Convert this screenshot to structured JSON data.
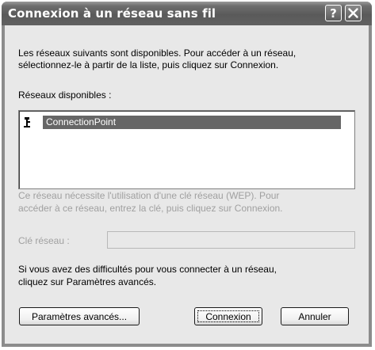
{
  "window": {
    "title": "Connexion à un réseau sans fil",
    "help_icon": "help-question-icon",
    "close_icon": "close-x-icon"
  },
  "intro": {
    "line1": "Les réseaux suivants sont disponibles. Pour accéder à un réseau,",
    "line2": "sélectionnez-le à partir de la liste, puis cliquez sur Connexion."
  },
  "networks": {
    "label": "Réseaux disponibles :",
    "items": [
      {
        "name": "ConnectionPoint",
        "icon": "wireless-antenna-icon",
        "selected": true
      }
    ]
  },
  "wep_notice": {
    "line1": "Ce réseau nécessite l'utilisation d'une clé réseau (WEP). Pour",
    "line2": "accéder à ce réseau, entrez la clé, puis cliquez sur Connexion."
  },
  "network_key": {
    "label": "Clé réseau :",
    "value": ""
  },
  "help_text": {
    "line1": "Si vous avez des difficultés pour vous connecter à un réseau,",
    "line2": "cliquez sur Paramètres avancés."
  },
  "buttons": {
    "advanced": "Paramètres avancés...",
    "connect": "Connexion",
    "cancel": "Annuler"
  }
}
